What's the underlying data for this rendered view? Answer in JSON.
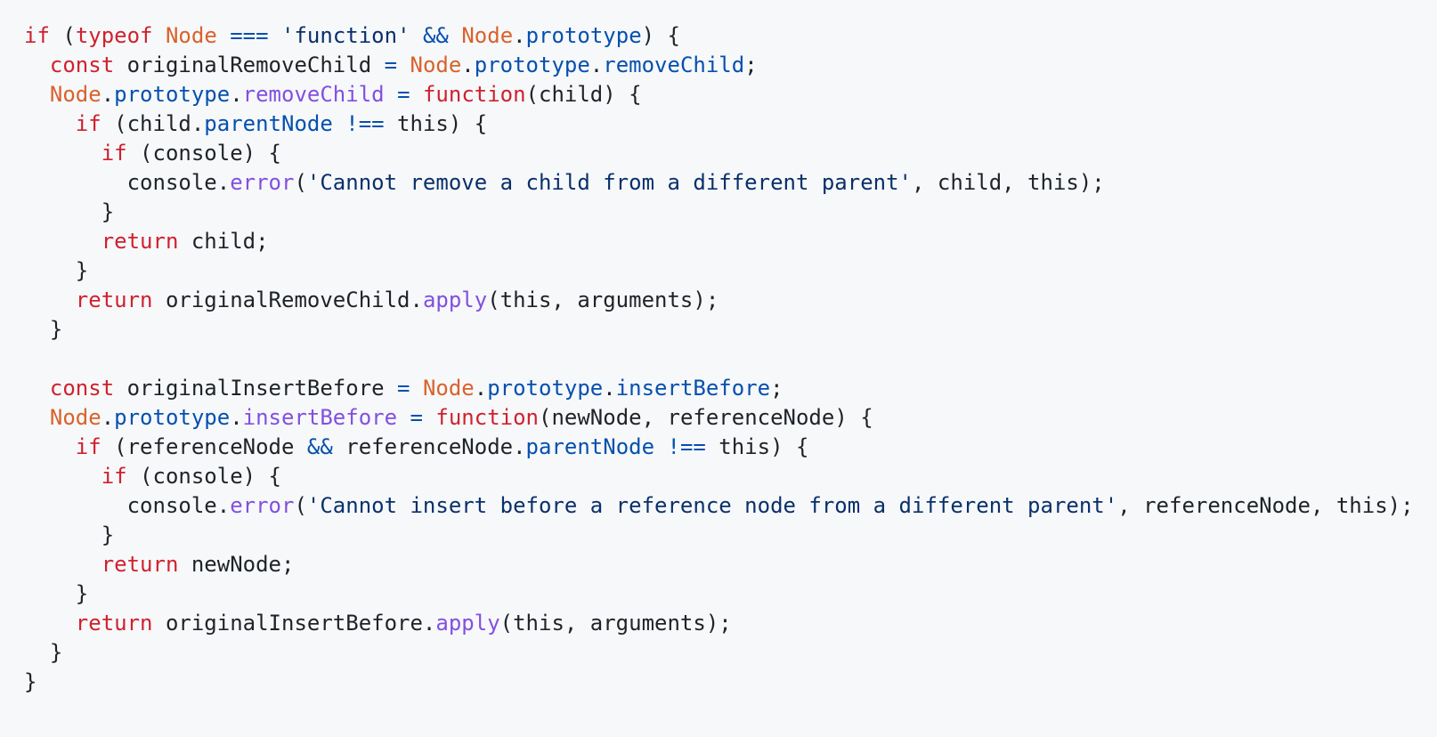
{
  "code": {
    "language": "javascript",
    "colors": {
      "keyword": "#cf222e",
      "entity": "#d9622b",
      "constant": "#0550ae",
      "function": "#8250df",
      "string": "#0a3069",
      "text": "#1f2328",
      "background": "#f6f8fa"
    },
    "lines": [
      [
        [
          "k",
          "if"
        ],
        [
          "t",
          " ("
        ],
        [
          "k",
          "typeof"
        ],
        [
          "t",
          " "
        ],
        [
          "e",
          "Node"
        ],
        [
          "t",
          " "
        ],
        [
          "c",
          "==="
        ],
        [
          "t",
          " "
        ],
        [
          "s",
          "'function'"
        ],
        [
          "t",
          " "
        ],
        [
          "c",
          "&&"
        ],
        [
          "t",
          " "
        ],
        [
          "e",
          "Node"
        ],
        [
          "t",
          "."
        ],
        [
          "c",
          "prototype"
        ],
        [
          "t",
          ") {"
        ]
      ],
      [
        [
          "t",
          "  "
        ],
        [
          "k",
          "const"
        ],
        [
          "t",
          " originalRemoveChild "
        ],
        [
          "c",
          "="
        ],
        [
          "t",
          " "
        ],
        [
          "e",
          "Node"
        ],
        [
          "t",
          "."
        ],
        [
          "c",
          "prototype"
        ],
        [
          "t",
          "."
        ],
        [
          "c",
          "removeChild"
        ],
        [
          "t",
          ";"
        ]
      ],
      [
        [
          "t",
          "  "
        ],
        [
          "e",
          "Node"
        ],
        [
          "t",
          "."
        ],
        [
          "c",
          "prototype"
        ],
        [
          "t",
          "."
        ],
        [
          "f",
          "removeChild"
        ],
        [
          "t",
          " "
        ],
        [
          "c",
          "="
        ],
        [
          "t",
          " "
        ],
        [
          "k",
          "function"
        ],
        [
          "t",
          "(child) {"
        ]
      ],
      [
        [
          "t",
          "    "
        ],
        [
          "k",
          "if"
        ],
        [
          "t",
          " (child."
        ],
        [
          "c",
          "parentNode"
        ],
        [
          "t",
          " "
        ],
        [
          "c",
          "!=="
        ],
        [
          "t",
          " this) {"
        ]
      ],
      [
        [
          "t",
          "      "
        ],
        [
          "k",
          "if"
        ],
        [
          "t",
          " (console) {"
        ]
      ],
      [
        [
          "t",
          "        console."
        ],
        [
          "f",
          "error"
        ],
        [
          "t",
          "("
        ],
        [
          "s",
          "'Cannot remove a child from a different parent'"
        ],
        [
          "t",
          ", child, this);"
        ]
      ],
      [
        [
          "t",
          "      }"
        ]
      ],
      [
        [
          "t",
          "      "
        ],
        [
          "k",
          "return"
        ],
        [
          "t",
          " child;"
        ]
      ],
      [
        [
          "t",
          "    }"
        ]
      ],
      [
        [
          "t",
          "    "
        ],
        [
          "k",
          "return"
        ],
        [
          "t",
          " originalRemoveChild."
        ],
        [
          "f",
          "apply"
        ],
        [
          "t",
          "(this, arguments);"
        ]
      ],
      [
        [
          "t",
          "  }"
        ]
      ],
      [],
      [
        [
          "t",
          "  "
        ],
        [
          "k",
          "const"
        ],
        [
          "t",
          " originalInsertBefore "
        ],
        [
          "c",
          "="
        ],
        [
          "t",
          " "
        ],
        [
          "e",
          "Node"
        ],
        [
          "t",
          "."
        ],
        [
          "c",
          "prototype"
        ],
        [
          "t",
          "."
        ],
        [
          "c",
          "insertBefore"
        ],
        [
          "t",
          ";"
        ]
      ],
      [
        [
          "t",
          "  "
        ],
        [
          "e",
          "Node"
        ],
        [
          "t",
          "."
        ],
        [
          "c",
          "prototype"
        ],
        [
          "t",
          "."
        ],
        [
          "f",
          "insertBefore"
        ],
        [
          "t",
          " "
        ],
        [
          "c",
          "="
        ],
        [
          "t",
          " "
        ],
        [
          "k",
          "function"
        ],
        [
          "t",
          "(newNode, referenceNode) {"
        ]
      ],
      [
        [
          "t",
          "    "
        ],
        [
          "k",
          "if"
        ],
        [
          "t",
          " (referenceNode "
        ],
        [
          "c",
          "&&"
        ],
        [
          "t",
          " referenceNode."
        ],
        [
          "c",
          "parentNode"
        ],
        [
          "t",
          " "
        ],
        [
          "c",
          "!=="
        ],
        [
          "t",
          " this) {"
        ]
      ],
      [
        [
          "t",
          "      "
        ],
        [
          "k",
          "if"
        ],
        [
          "t",
          " (console) {"
        ]
      ],
      [
        [
          "t",
          "        console."
        ],
        [
          "f",
          "error"
        ],
        [
          "t",
          "("
        ],
        [
          "s",
          "'Cannot insert before a reference node from a different parent'"
        ],
        [
          "t",
          ", referenceNode, this);"
        ]
      ],
      [
        [
          "t",
          "      }"
        ]
      ],
      [
        [
          "t",
          "      "
        ],
        [
          "k",
          "return"
        ],
        [
          "t",
          " newNode;"
        ]
      ],
      [
        [
          "t",
          "    }"
        ]
      ],
      [
        [
          "t",
          "    "
        ],
        [
          "k",
          "return"
        ],
        [
          "t",
          " originalInsertBefore."
        ],
        [
          "f",
          "apply"
        ],
        [
          "t",
          "(this, arguments);"
        ]
      ],
      [
        [
          "t",
          "  }"
        ]
      ],
      [
        [
          "t",
          "}"
        ]
      ]
    ]
  }
}
